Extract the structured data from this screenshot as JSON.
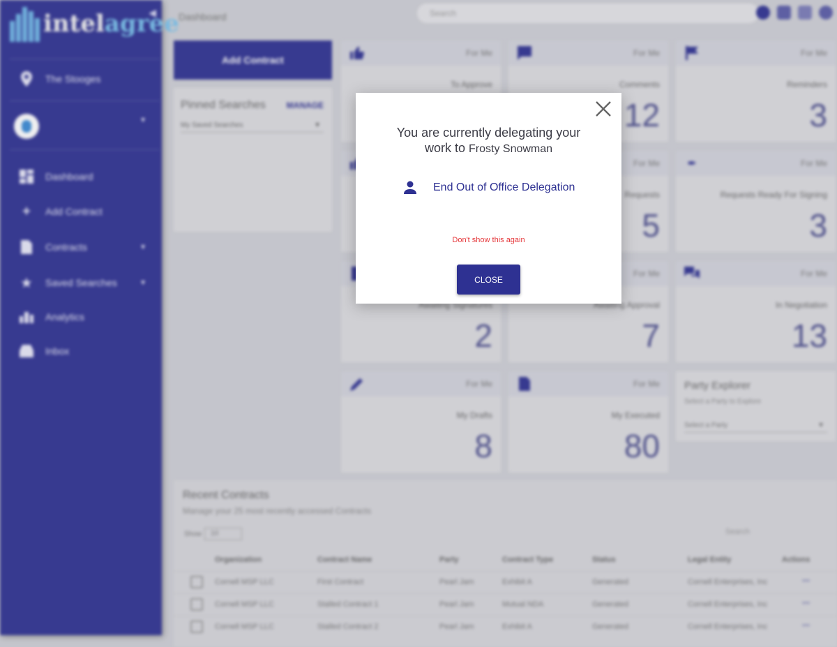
{
  "sidebar": {
    "logo_part1": "intel",
    "logo_part2": "agree",
    "org_name": "The Stooges",
    "items": [
      {
        "label": "Dashboard"
      },
      {
        "label": "Add Contract"
      },
      {
        "label": "Contracts"
      },
      {
        "label": "Saved Searches"
      },
      {
        "label": "Analytics"
      },
      {
        "label": "Inbox"
      }
    ]
  },
  "header": {
    "title": "Dashboard",
    "search_placeholder": "Search"
  },
  "add_contract_label": "Add Contract",
  "pinned": {
    "title": "Pinned Searches",
    "manage_label": "MANAGE",
    "select_label": "My Saved Searches"
  },
  "cards": [
    {
      "tag": "For Me",
      "label": "To Approve",
      "value": ""
    },
    {
      "tag": "For Me",
      "label": "Comments",
      "value": "12"
    },
    {
      "tag": "For Me",
      "label": "Reminders",
      "value": "3"
    },
    {
      "tag": "",
      "label": "",
      "value": ""
    },
    {
      "tag": "For Me",
      "label": "Requests",
      "value": "5"
    },
    {
      "tag": "For Me",
      "label": "Requests Ready For Signing",
      "value": "3"
    },
    {
      "tag": "",
      "label": "Awaiting Signatures",
      "value": "2"
    },
    {
      "tag": "For Me",
      "label": "Awaiting Approval",
      "value": "7"
    },
    {
      "tag": "For Me",
      "label": "In Negotiation",
      "value": "13"
    },
    {
      "tag": "For Me",
      "label": "My Drafts",
      "value": "8"
    },
    {
      "tag": "For Me",
      "label": "My Executed",
      "value": "80"
    }
  ],
  "party_explorer": {
    "title": "Party Explorer",
    "subtitle": "Select a Party to Explore",
    "select_label": "Select a Party"
  },
  "recent": {
    "title": "Recent Contracts",
    "subtitle": "Manage your 25 most recently accessed Contracts",
    "show_label": "Show",
    "show_value": "10",
    "search_placeholder": "Search",
    "columns": [
      "Organization",
      "Contract Name",
      "Party",
      "Contract Type",
      "Status",
      "Legal Entity",
      "Actions"
    ],
    "rows": [
      [
        "Cornell MSP LLC",
        "First Contract",
        "Pearl Jam",
        "Exhibit A",
        "Generated",
        "Cornell Enterprises, Inc",
        "⋯"
      ],
      [
        "Cornell MSP LLC",
        "Stalled Contract 1",
        "Pearl Jam",
        "Mutual NDA",
        "Generated",
        "Cornell Enterprises, Inc",
        "⋯"
      ],
      [
        "Cornell MSP LLC",
        "Stalled Contract 2",
        "Pearl Jam",
        "Exhibit A",
        "Generated",
        "Cornell Enterprises, Inc",
        "⋯"
      ]
    ]
  },
  "dialog": {
    "line1": "You are currently delegating your",
    "line2": "work to",
    "delegate_name": "Frosty Snowman",
    "end_label": "End Out of Office Delegation",
    "dont_show": "Don't show this again",
    "close_label": "CLOSE",
    "icons": [
      "close-icon",
      "person-icon"
    ]
  },
  "colors": {
    "primary": "#2e3192",
    "accent_red": "#e5373a",
    "logo_light_blue": "#79c3ee"
  }
}
